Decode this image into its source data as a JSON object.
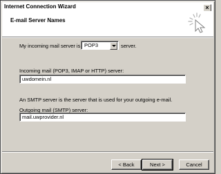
{
  "window": {
    "title": "Internet Connection Wizard",
    "close_glyph": "×"
  },
  "header": {
    "title": "E-mail Server Names",
    "icon": "wizard-cursor-icon"
  },
  "incoming_type": {
    "prefix": "My incoming mail server is a",
    "selected": "POP3",
    "suffix": "server."
  },
  "incoming": {
    "label": "Incoming mail (POP3, IMAP or HTTP) server:",
    "value": "uwdomein.nl"
  },
  "smtp_info": "An SMTP server is the server that is used for your outgoing e-mail.",
  "outgoing": {
    "label": "Outgoing mail (SMTP) server:",
    "value": "mail.uwprovider.nl"
  },
  "buttons": {
    "back": "< Back",
    "next": "Next >",
    "cancel": "Cancel"
  }
}
